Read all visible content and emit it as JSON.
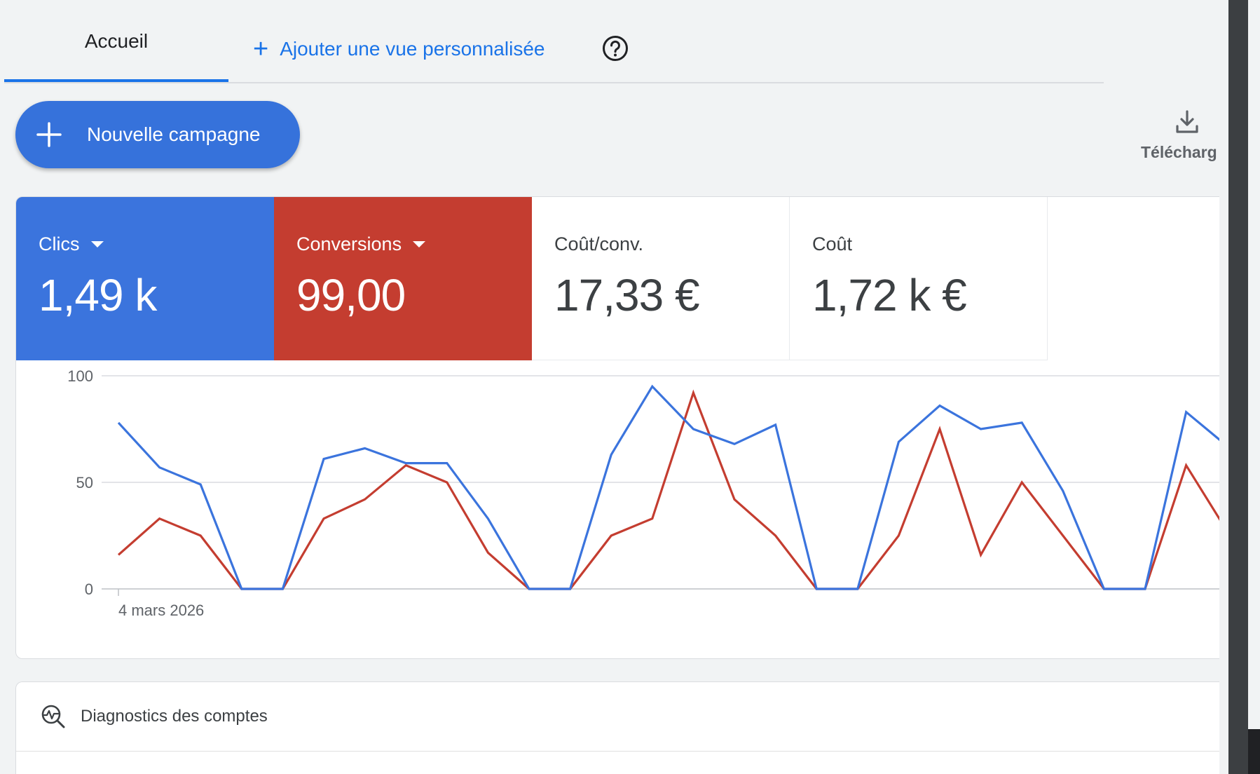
{
  "tabs": {
    "home_label": "Accueil",
    "add_view_label": "Ajouter une vue personnalisée",
    "add_view_icon": "plus-icon",
    "help_icon": "help-circle-icon"
  },
  "toolbar": {
    "new_campaign_label": "Nouvelle campagne",
    "new_campaign_icon": "plus-icon",
    "download_label": "Télécharg",
    "download_icon": "download-icon"
  },
  "metrics": [
    {
      "label": "Clics",
      "value": "1,49 k",
      "has_dropdown": true,
      "color": "#3b74dd"
    },
    {
      "label": "Conversions",
      "value": "99,00",
      "has_dropdown": true,
      "color": "#c43d30"
    },
    {
      "label": "Coût/conv.",
      "value": "17,33 €",
      "has_dropdown": false
    },
    {
      "label": "Coût",
      "value": "1,72 k €",
      "has_dropdown": false
    }
  ],
  "chart_data": {
    "type": "line",
    "x_start_label": "4 mars 2026",
    "ylim": [
      0,
      100
    ],
    "y_ticks": [
      "0",
      "50",
      "100"
    ],
    "grid": true,
    "series": [
      {
        "name": "Clics",
        "color": "#3b74dd",
        "values": [
          78,
          57,
          49,
          0,
          0,
          61,
          66,
          59,
          59,
          33,
          0,
          0,
          63,
          95,
          75,
          68,
          77,
          0,
          0,
          69,
          86,
          75,
          78,
          46,
          0,
          0,
          83,
          67
        ]
      },
      {
        "name": "Conversions",
        "color": "#c43d30",
        "values": [
          16,
          33,
          25,
          0,
          0,
          33,
          42,
          58,
          50,
          17,
          0,
          0,
          25,
          33,
          92,
          42,
          25,
          0,
          0,
          25,
          75,
          16,
          50,
          25,
          0,
          0,
          58,
          27
        ]
      }
    ]
  },
  "diagnostics": {
    "label": "Diagnostics des comptes",
    "icon": "diagnostics-icon"
  }
}
